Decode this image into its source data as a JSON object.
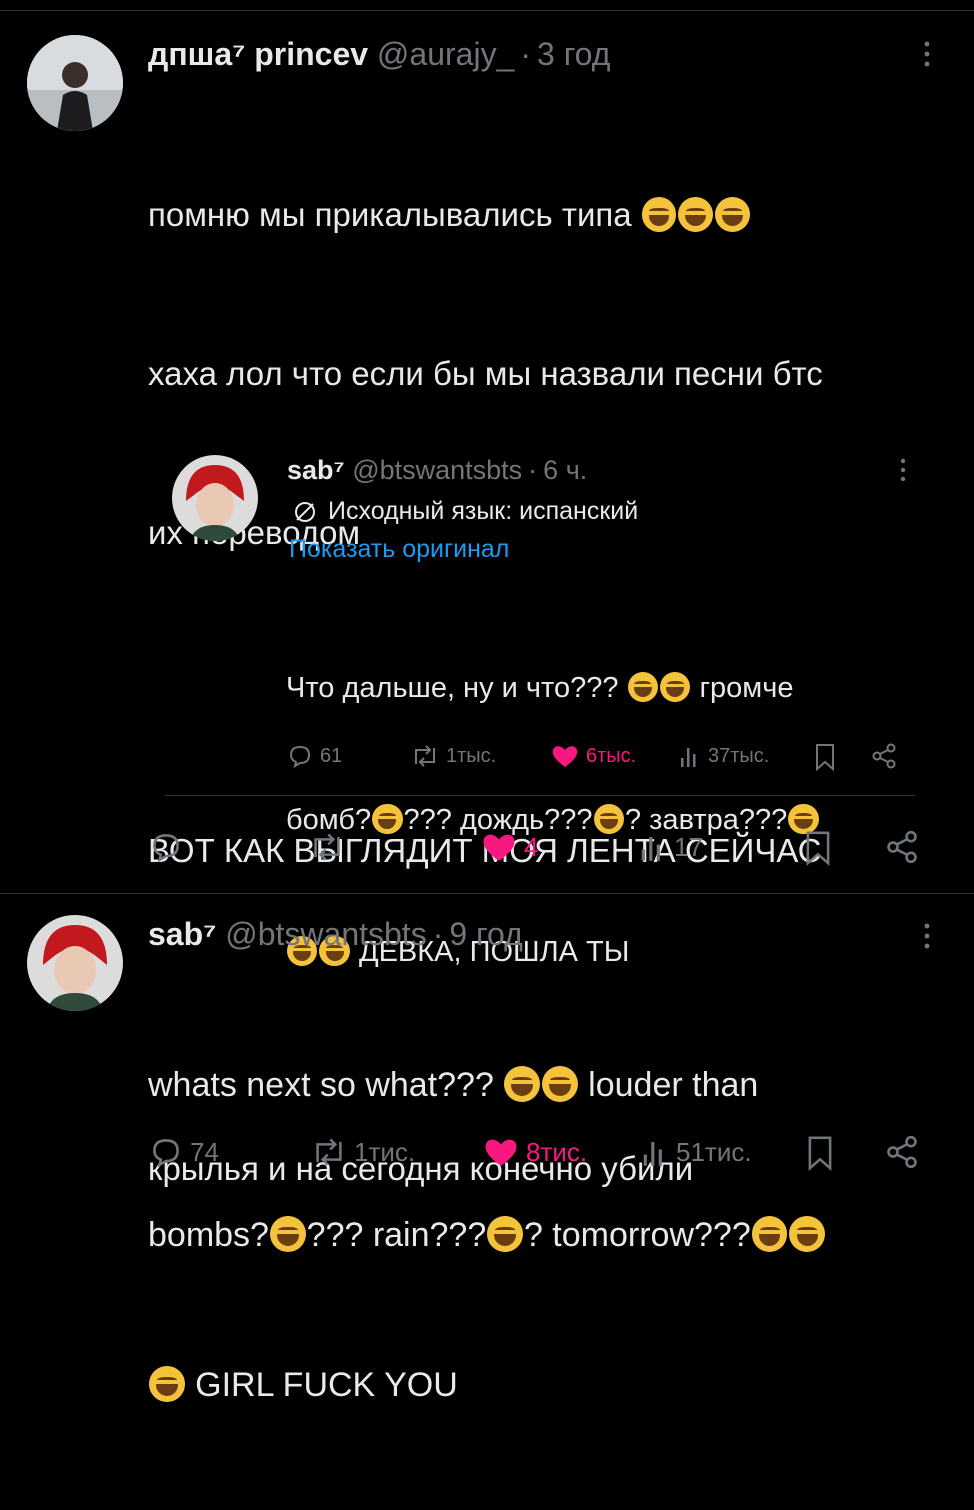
{
  "post1": {
    "display_name": "дпша⁷ princev",
    "handle": "@aurajy_",
    "time": "3 год",
    "lines": [
      "помню мы прикалывались типа",
      "хаха лол что если бы мы назвали песни бтс",
      "их переводом",
      "ВОТ КАК ВЫГЛЯДИТ МОЯ ЛЕНТА СЕЙЧАС",
      "крылья и на сегодня конечно убили"
    ],
    "replies": "",
    "retweets": "",
    "likes": "4",
    "views": "17"
  },
  "quote": {
    "display_name": "sab⁷",
    "handle": "@btswantsbts",
    "time": "6 ч.",
    "translated_from": "Исходный язык: испанский",
    "show_original": "Показать оригинал",
    "line1a": "Что дальше, ну и что???",
    "line1b": "громче",
    "line2a": "бомб?",
    "line2b": "??? дождь???",
    "line2c": "? завтра???",
    "line3": "ДЕВКА, ПОШЛА ТЫ",
    "replies": "61",
    "retweets": "1тыс.",
    "likes": "6тыс.",
    "views": "37тыс."
  },
  "post2": {
    "display_name": "sab⁷",
    "handle": "@btswantsbts",
    "time": "9 год",
    "line1a": "whats next so what???",
    "line1b": "louder than",
    "line2a": "bombs?",
    "line2b": "??? rain???",
    "line2c": "? tomorrow???",
    "line3": "GIRL FUCK YOU",
    "replies": "74",
    "retweets": "1тис.",
    "likes": "8тис.",
    "views": "51тис."
  },
  "colors": {
    "accent_like": "#f91880",
    "link": "#1d9bf0",
    "muted": "#71767b",
    "text": "#e7e9ea"
  }
}
